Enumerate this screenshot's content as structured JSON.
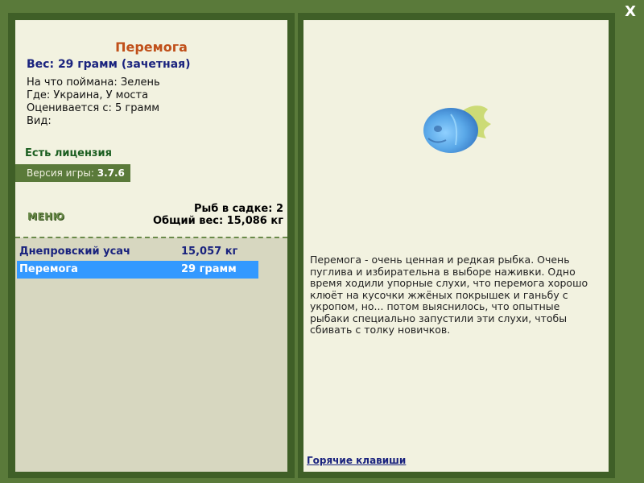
{
  "close_label": "X",
  "fish": {
    "name": "Перемога",
    "weight": "Вес: 29 грамм (зачетная)",
    "caught_on": "На что поймана: Зелень",
    "location": "Где: Украина, У моста",
    "valued_from": "Оценивается с: 5 грамм",
    "species": "Вид:",
    "description": "Перемога - очень ценная и редкая рыбка. Очень пуглива и избирательна в выборе наживки. Одно время ходили упорные слухи, что перемога хорошо клюёт на кусочки жжёных покрышек и ганьбу с укропом, но... потом выяснилось, что опытные рыбаки специально запустили эти слухи, чтобы сбивать с толку новичков.",
    "image_icon": "fish-icon"
  },
  "license_text": "Есть лицензия",
  "version": {
    "label": "Версия игры: ",
    "value": "3.7.6"
  },
  "menu_label": "МЕНЮ",
  "keeper": {
    "count": "Рыб в садке: 2",
    "total_weight": "Общий вес: 15,086 кг"
  },
  "catch_list": [
    {
      "name": "Днепровский усач",
      "weight": "15,057 кг",
      "selected": false
    },
    {
      "name": "Перемога",
      "weight": "29 грамм",
      "selected": true
    }
  ],
  "hotkeys_label": "Горячие клавиши",
  "colors": {
    "background": "#5a7a3a",
    "title": "#c0501a",
    "selection": "#3399ff",
    "link": "#1a237e"
  }
}
